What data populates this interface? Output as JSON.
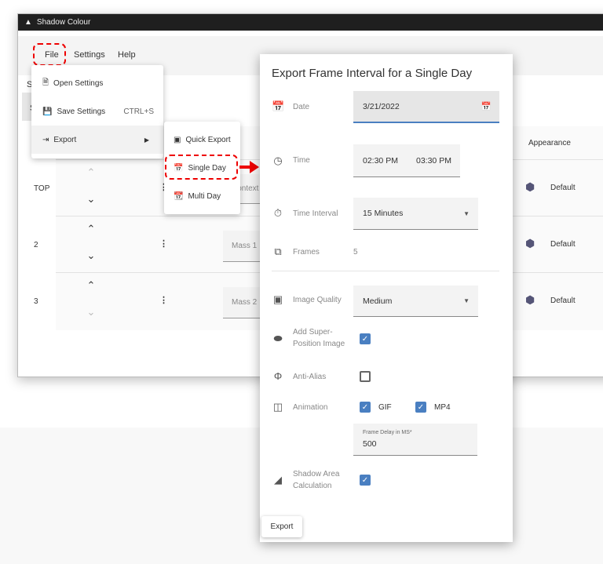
{
  "window": {
    "title": "Shadow Colour"
  },
  "menubar": {
    "file": "File",
    "settings": "Settings",
    "help": "Help"
  },
  "file_menu": {
    "items": [
      {
        "label": "Open Settings",
        "icon": "file-icon"
      },
      {
        "label": "Save Settings",
        "shortcut": "CTRL+S",
        "icon": "save-icon"
      },
      {
        "label": "Export",
        "icon": "export-icon"
      }
    ]
  },
  "export_submenu": {
    "items": [
      {
        "label": "Quick Export",
        "icon": "image-icon"
      },
      {
        "label": "Single Day",
        "icon": "calendar-icon"
      },
      {
        "label": "Multi Day",
        "icon": "calendar-multi-icon"
      }
    ]
  },
  "background": {
    "partial_s1": "S",
    "partial_s2": "S"
  },
  "table": {
    "appearance_header": "Appearance",
    "rows": [
      {
        "order": "TOP",
        "name": "Context",
        "appearance": "Default"
      },
      {
        "order": "2",
        "name": "Mass 1",
        "appearance": "Default"
      },
      {
        "order": "3",
        "name": "Mass 2",
        "appearance": "Default"
      }
    ]
  },
  "dialog": {
    "title": "Export Frame Interval for a Single Day",
    "date_label": "Date",
    "date_value": "3/21/2022",
    "time_label": "Time",
    "time_start": "02:30 PM",
    "time_end": "03:30 PM",
    "interval_label": "Time Interval",
    "interval_value": "15 Minutes",
    "frames_label": "Frames",
    "frames_value": "5",
    "quality_label": "Image Quality",
    "quality_value": "Medium",
    "superposition_label_1": "Add Super-",
    "superposition_label_2": "Position Image",
    "superposition_checked": true,
    "antialias_label": "Anti-Alias",
    "antialias_checked": false,
    "animation_label": "Animation",
    "gif_label": "GIF",
    "gif_checked": true,
    "mp4_label": "MP4",
    "mp4_checked": true,
    "frame_delay_label": "Frame Delay in MS*",
    "frame_delay_value": "500",
    "shadow_label_1": "Shadow Area",
    "shadow_label_2": "Calculation",
    "shadow_checked": true,
    "export_button": "Export"
  },
  "colors": {
    "accent": "#4a7fc1",
    "highlight": "#e00000"
  }
}
